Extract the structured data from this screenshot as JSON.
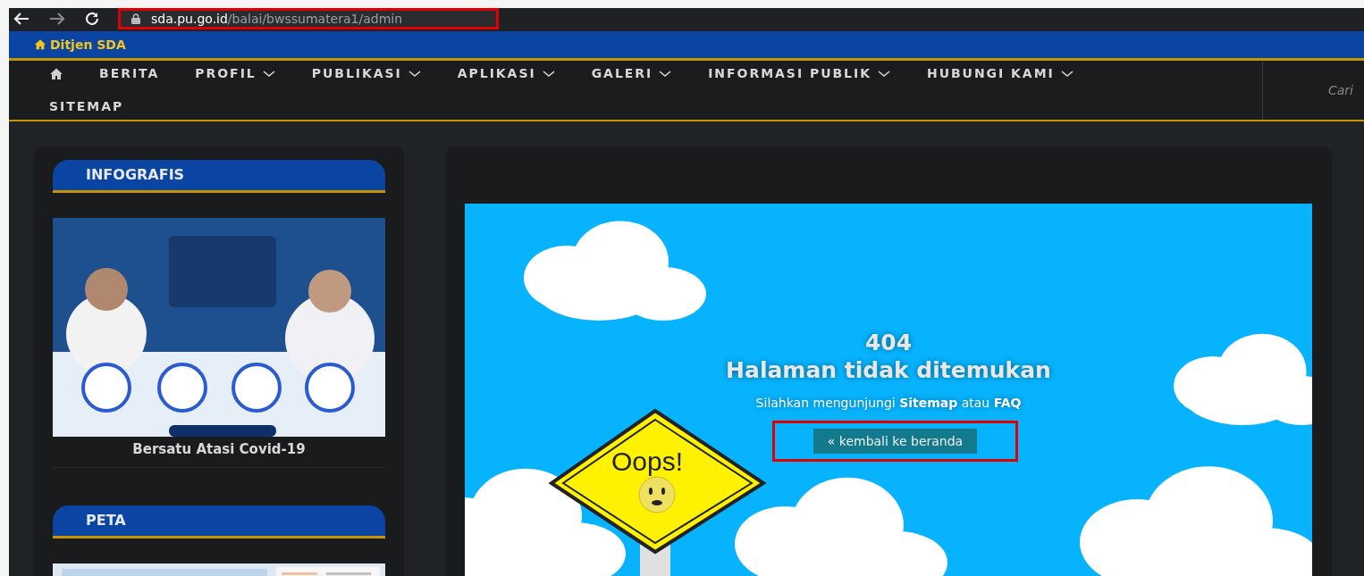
{
  "browser": {
    "address_bar": {
      "host": "sda.pu.go.id",
      "path": "/balai/bwssumatera1/admin",
      "highlighted": true
    }
  },
  "top_bar": {
    "brand": "Ditjen SDA"
  },
  "nav": {
    "items": [
      {
        "kind": "home"
      },
      {
        "kind": "link",
        "label": "BERITA",
        "has_dropdown": false
      },
      {
        "kind": "link",
        "label": "PROFIL",
        "has_dropdown": true
      },
      {
        "kind": "link",
        "label": "PUBLIKASI",
        "has_dropdown": true
      },
      {
        "kind": "link",
        "label": "APLIKASI",
        "has_dropdown": true
      },
      {
        "kind": "link",
        "label": "GALERI",
        "has_dropdown": true
      },
      {
        "kind": "link",
        "label": "INFORMASI PUBLIK",
        "has_dropdown": true
      },
      {
        "kind": "link",
        "label": "HUBUNGI KAMI",
        "has_dropdown": true
      },
      {
        "kind": "link",
        "label": "SITEMAP",
        "has_dropdown": false
      }
    ],
    "search": {
      "placeholder": "Cari"
    }
  },
  "sidebar": {
    "sections": [
      {
        "title": "INFOGRAFIS",
        "caption": "Bersatu Atasi Covid-19"
      },
      {
        "title": "PETA"
      }
    ]
  },
  "error_page": {
    "code": "404",
    "title": "Halaman tidak ditemukan",
    "message": "Silahkan mengunjungi **Sitemap** atau **FAQ**",
    "button": {
      "label": "« kembali ke beranda",
      "highlighted": true
    },
    "sign_text": "Oops!"
  }
}
